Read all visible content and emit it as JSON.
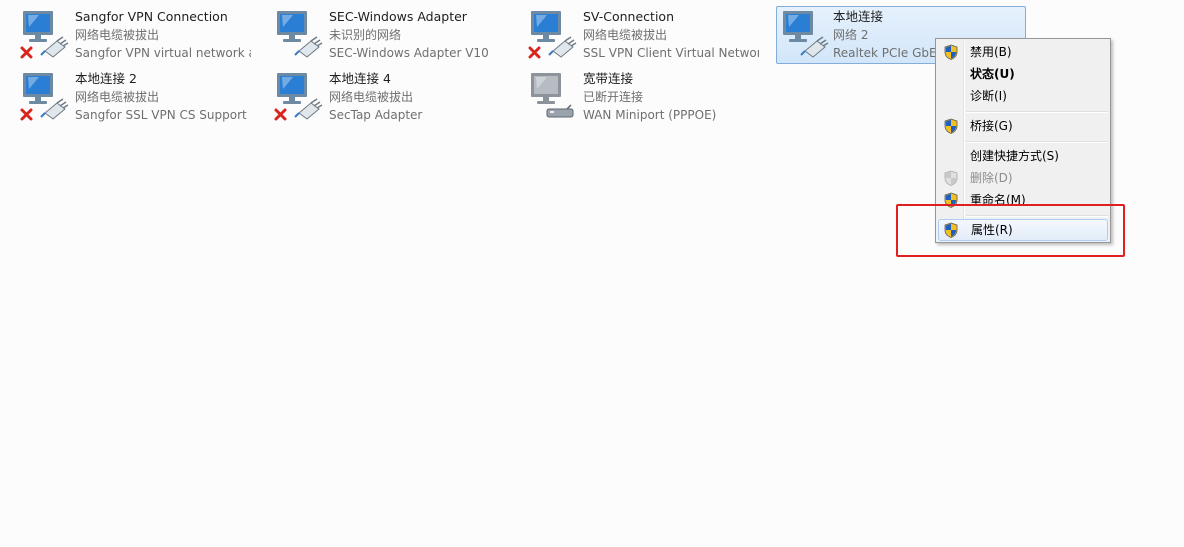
{
  "connections": [
    {
      "name": "Sangfor VPN Connection",
      "status": "网络电缆被拔出",
      "device": "Sangfor VPN virtual network a...",
      "icon": "network-disconnected-icon"
    },
    {
      "name": "SEC-Windows Adapter",
      "status": "未识别的网络",
      "device": "SEC-Windows Adapter V10",
      "icon": "network-connected-icon"
    },
    {
      "name": "SV-Connection",
      "status": "网络电缆被拔出",
      "device": "SSL VPN Client Virtual Networ...",
      "icon": "network-disconnected-icon"
    },
    {
      "name": "本地连接",
      "status": "网络  2",
      "device": "Realtek PCIe GbE",
      "icon": "network-connected-icon"
    },
    {
      "name": "本地连接 2",
      "status": "网络电缆被拔出",
      "device": "Sangfor SSL VPN CS Support ...",
      "icon": "network-disconnected-icon"
    },
    {
      "name": "本地连接 4",
      "status": "网络电缆被拔出",
      "device": "SecTap Adapter",
      "icon": "network-disconnected-icon"
    },
    {
      "name": "宽带连接",
      "status": "已断开连接",
      "device": "WAN Miniport (PPPOE)",
      "icon": "broadband-disconnected-icon"
    }
  ],
  "context_menu": {
    "items": [
      {
        "label": "禁用(B)",
        "icon": "uac-shield-icon"
      },
      {
        "label": "状态(U)"
      },
      {
        "label": "诊断(I)"
      },
      {
        "label": "桥接(G)",
        "icon": "uac-shield-icon"
      },
      {
        "label": "创建快捷方式(S)"
      },
      {
        "label": "删除(D)",
        "icon": "uac-shield-icon",
        "disabled": true
      },
      {
        "label": "重命名(M)",
        "icon": "uac-shield-icon"
      },
      {
        "label": "属性(R)",
        "icon": "uac-shield-icon",
        "hovered": true
      }
    ]
  },
  "colors": {
    "highlight": "#e02020",
    "selection": "#d2e6fa",
    "menu_background": "#f0f0f0"
  }
}
